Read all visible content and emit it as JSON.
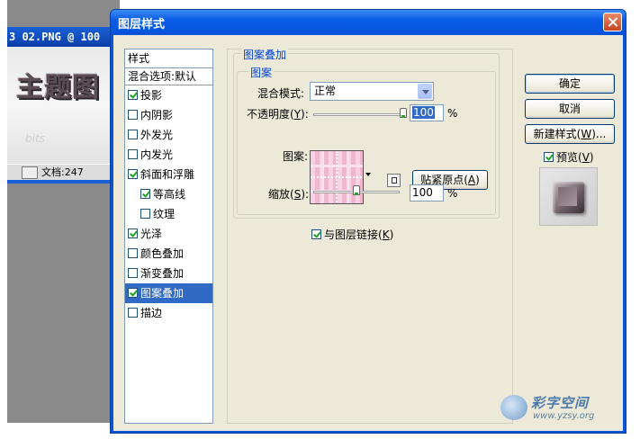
{
  "background_window": {
    "title": "3 02.PNG @ 100",
    "canvas_text": "主题图",
    "canvas_faint_text": "bits",
    "status_text": "文档:247"
  },
  "dialog": {
    "title": "图层样式",
    "styles_header": "样式",
    "blend_options": "混合选项:默认",
    "styles": [
      {
        "label": "投影",
        "checked": true
      },
      {
        "label": "内阴影",
        "checked": false
      },
      {
        "label": "外发光",
        "checked": false
      },
      {
        "label": "内发光",
        "checked": false
      },
      {
        "label": "斜面和浮雕",
        "checked": true
      },
      {
        "label": "等高线",
        "checked": true,
        "sub": true
      },
      {
        "label": "纹理",
        "checked": false,
        "sub": true
      },
      {
        "label": "光泽",
        "checked": true
      },
      {
        "label": "颜色叠加",
        "checked": false
      },
      {
        "label": "渐变叠加",
        "checked": false
      },
      {
        "label": "图案叠加",
        "checked": true,
        "selected": true
      },
      {
        "label": "描边",
        "checked": false
      }
    ],
    "panel": {
      "group_title": "图案叠加",
      "subgroup_title": "图案",
      "blend_mode_label": "混合模式:",
      "blend_mode_value": "正常",
      "opacity_label_pre": "不透明度(",
      "opacity_label_key": "Y",
      "opacity_label_post": "):",
      "opacity_value": "100",
      "opacity_unit": "%",
      "opacity_level": 1.0,
      "pattern_label": "图案:",
      "snap_button_pre": "贴紧原点(",
      "snap_button_key": "A",
      "snap_button_post": ")",
      "scale_label_pre": "缩放(",
      "scale_label_key": "S",
      "scale_label_post": "):",
      "scale_value": "100",
      "scale_unit": "%",
      "scale_level": 0.5,
      "link_label_pre": "与图层链接(",
      "link_label_key": "K",
      "link_label_post": ")",
      "link_checked": true
    },
    "buttons": {
      "ok": "确定",
      "cancel": "取消",
      "new_style_pre": "新建样式(",
      "new_style_key": "W",
      "new_style_post": ")..."
    },
    "preview": {
      "label_pre": "预览(",
      "label_key": "V",
      "label_post": ")",
      "checked": true
    }
  },
  "watermark": {
    "title": "彩字空间",
    "url": "www.yzsy.org"
  },
  "colors": {
    "title_bar": "#0a5ce6",
    "selection": "#316ac5",
    "group_label": "#0046d5",
    "dialog_face": "#ece9d8"
  }
}
